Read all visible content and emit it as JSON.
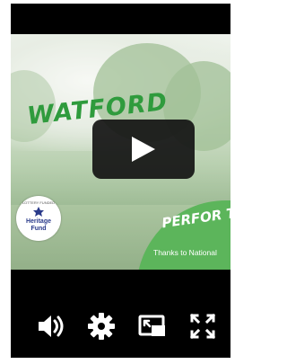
{
  "video": {
    "title_text": "WATFORD",
    "tagline_text": "PERFOR TRA",
    "thanks_text": "Thanks to National",
    "logo": {
      "small_text": "LOTTERY FUNDED",
      "heritage_text": "Heritage",
      "fund_text": "Fund"
    }
  },
  "play_button": {
    "icon": "play-icon"
  },
  "controls": [
    {
      "icon": "volume-icon"
    },
    {
      "icon": "settings-gear-icon"
    },
    {
      "icon": "picture-in-picture-icon"
    },
    {
      "icon": "fullscreen-icon"
    }
  ],
  "colors": {
    "player_bg": "#000000",
    "brand_green": "#2f9b3d",
    "accent_green": "#5cb55b",
    "heritage_blue": "#2a3a8a"
  }
}
